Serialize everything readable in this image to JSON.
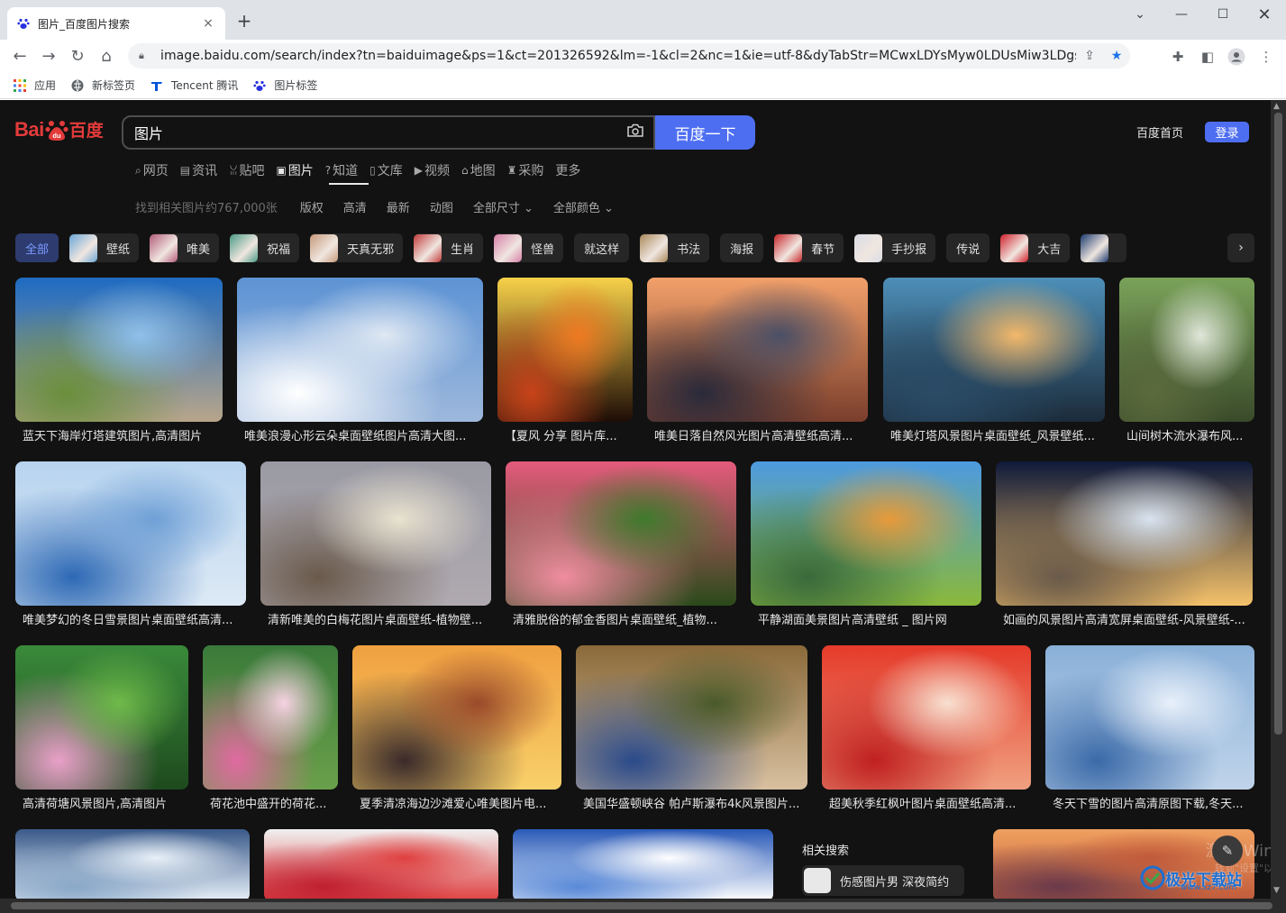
{
  "browser": {
    "tab_title": "图片_百度图片搜索",
    "tab_close": "×",
    "new_tab": "+",
    "url": "image.baidu.com/search/index?tn=baiduimage&ps=1&ct=201326592&lm=-1&cl=2&nc=1&ie=utf-8&dyTabStr=MCwxLDYsMyw0LDUsMiw3LDgsOQ%3...",
    "bookmarks": [
      {
        "label": "应用",
        "icon": "apps-grid-icon"
      },
      {
        "label": "新标签页",
        "icon": "globe-icon"
      },
      {
        "label": "Tencent 腾讯",
        "icon": "tencent-icon"
      },
      {
        "label": "图片标签",
        "icon": "baidu-paw-icon"
      }
    ]
  },
  "page": {
    "logo_text_left": "Bai",
    "logo_text_right": "百度",
    "search_query": "图片",
    "search_button": "百度一下",
    "home_link": "百度首页",
    "login_button": "登录",
    "nav_tabs": [
      {
        "label": "网页",
        "icon": "⌕"
      },
      {
        "label": "资讯",
        "icon": "▤"
      },
      {
        "label": "贴吧",
        "icon": "ꈍ"
      },
      {
        "label": "图片",
        "icon": "▣"
      },
      {
        "label": "知道",
        "icon": "?"
      },
      {
        "label": "文库",
        "icon": "▯"
      },
      {
        "label": "视频",
        "icon": "▶"
      },
      {
        "label": "地图",
        "icon": "⌂"
      },
      {
        "label": "采购",
        "icon": "♜"
      },
      {
        "label": "更多",
        "icon": ""
      }
    ],
    "result_count": "找到相关图片约767,000张",
    "filters": [
      "版权",
      "高清",
      "最新",
      "动图",
      "全部尺寸",
      "全部颜色"
    ],
    "chips": [
      {
        "label": "全部",
        "thumb": ""
      },
      {
        "label": "壁纸",
        "thumb": "#6aa7d6"
      },
      {
        "label": "唯美",
        "thumb": "#b35c7a"
      },
      {
        "label": "祝福",
        "thumb": "#4a9b86"
      },
      {
        "label": "天真无邪",
        "thumb": "#c69a7a"
      },
      {
        "label": "生肖",
        "thumb": "#c23b3b"
      },
      {
        "label": "怪兽",
        "thumb": "#d77fa8"
      },
      {
        "label": "就这样",
        "thumb": ""
      },
      {
        "label": "书法",
        "thumb": "#a9885a"
      },
      {
        "label": "海报",
        "thumb": ""
      },
      {
        "label": "春节",
        "thumb": "#c8272a"
      },
      {
        "label": "手抄报",
        "thumb": "#dadde6"
      },
      {
        "label": "传说",
        "thumb": ""
      },
      {
        "label": "大吉",
        "thumb": "#d0202a"
      },
      {
        "label": "",
        "thumb": "#1b3a6d"
      }
    ],
    "chip_next": "›",
    "rows": [
      [
        {
          "caption": "蓝天下海岸灯塔建筑图片,高清图片",
          "colors": [
            "#1e6bc2",
            "#8fc0ea",
            "#6a8f3c",
            "#b8a58a"
          ]
        },
        {
          "caption": "唯美浪漫心形云朵桌面壁纸图片高清大图...",
          "colors": [
            "#5d93d4",
            "#dfe8f3",
            "#ffffff",
            "#9db8dc"
          ]
        },
        {
          "caption": "【夏风 分享 图片库...",
          "colors": [
            "#f7d14a",
            "#ef7a22",
            "#c8431a",
            "#1d0c06"
          ]
        },
        {
          "caption": "唯美日落自然风光图片高清壁纸高清...",
          "colors": [
            "#f2a06a",
            "#4a4f66",
            "#2a2a3a",
            "#7a3e2c"
          ]
        },
        {
          "caption": "唯美灯塔风景图片桌面壁纸_风景壁纸...",
          "colors": [
            "#4d8fb8",
            "#f2b86a",
            "#2a4b66",
            "#1b2b3a"
          ]
        },
        {
          "caption": "山间树木流水瀑布风...",
          "colors": [
            "#7aa25a",
            "#dfe7d9",
            "#5a6a3c",
            "#3a4a2a"
          ]
        }
      ],
      [
        {
          "caption": "唯美梦幻的冬日雪景图片桌面壁纸高清...",
          "colors": [
            "#b8d4ef",
            "#6fa0d6",
            "#2d69b5",
            "#dde9f5"
          ]
        },
        {
          "caption": "清新唯美的白梅花图片桌面壁纸-植物壁...",
          "colors": [
            "#9a9aa4",
            "#e8e2cf",
            "#6a5a4c",
            "#b0aab0"
          ]
        },
        {
          "caption": "清雅脱俗的郁金香图片桌面壁纸_植物...",
          "colors": [
            "#e55b7c",
            "#3f7a2c",
            "#f08da0",
            "#2a4a1a"
          ]
        },
        {
          "caption": "平静湖面美景图片高清壁纸 _ 图片网",
          "colors": [
            "#4d9ae0",
            "#e79a3a",
            "#3a6a3a",
            "#8ab83a"
          ]
        },
        {
          "caption": "如画的风景图片高清宽屏桌面壁纸-风景壁纸-...",
          "colors": [
            "#0f1a3a",
            "#d8e3f0",
            "#6a5a4a",
            "#f5c26a"
          ]
        }
      ],
      [
        {
          "caption": "高清荷塘风景图片,高清图片",
          "colors": [
            "#3a8a3a",
            "#6fba4a",
            "#e9a0c8",
            "#1e4a1e"
          ]
        },
        {
          "caption": "荷花池中盛开的荷花...",
          "colors": [
            "#3a7a3a",
            "#f6d2e2",
            "#e06aa0",
            "#6aa04a"
          ]
        },
        {
          "caption": "夏季清凉海边沙滩爱心唯美图片电...",
          "colors": [
            "#f0a040",
            "#9a4a2a",
            "#3a2a2a",
            "#f8d06a"
          ]
        },
        {
          "caption": "美国华盛顿峡谷 帕卢斯瀑布4k风景图片...",
          "colors": [
            "#8a6a3a",
            "#4a5a2a",
            "#2a4a8a",
            "#d8c0a0"
          ]
        },
        {
          "caption": "超美秋季红枫叶图片桌面壁纸高清...",
          "colors": [
            "#e53a2a",
            "#f8e0d0",
            "#c02020",
            "#f0a080"
          ]
        },
        {
          "caption": "冬天下雪的图片高清原图下载,冬天...",
          "colors": [
            "#8ab0d8",
            "#e8f0fa",
            "#3a6aa8",
            "#c0d4ea"
          ]
        }
      ],
      [
        {
          "caption": "",
          "colors": [
            "#3a5a8a",
            "#e8f0f8",
            "#8aa8c8"
          ]
        },
        {
          "caption": "",
          "colors": [
            "#f0f0f0",
            "#e04040",
            "#c02030"
          ]
        },
        {
          "caption": "",
          "colors": [
            "#2a5ab8",
            "#ffffff",
            "#5a8ad8"
          ]
        },
        {
          "caption": "",
          "colors": [
            "#f0a060",
            "#c05a3a",
            "#6a3a4a"
          ]
        }
      ]
    ],
    "related_title": "相关搜索",
    "related_item": "伤感图片男 深夜简约",
    "watermark": "激活 Wind",
    "watermark_sub": "转到\"设置\"以激",
    "brand_logo": "极光下载站",
    "brand_sub": "www.xz7.com"
  }
}
